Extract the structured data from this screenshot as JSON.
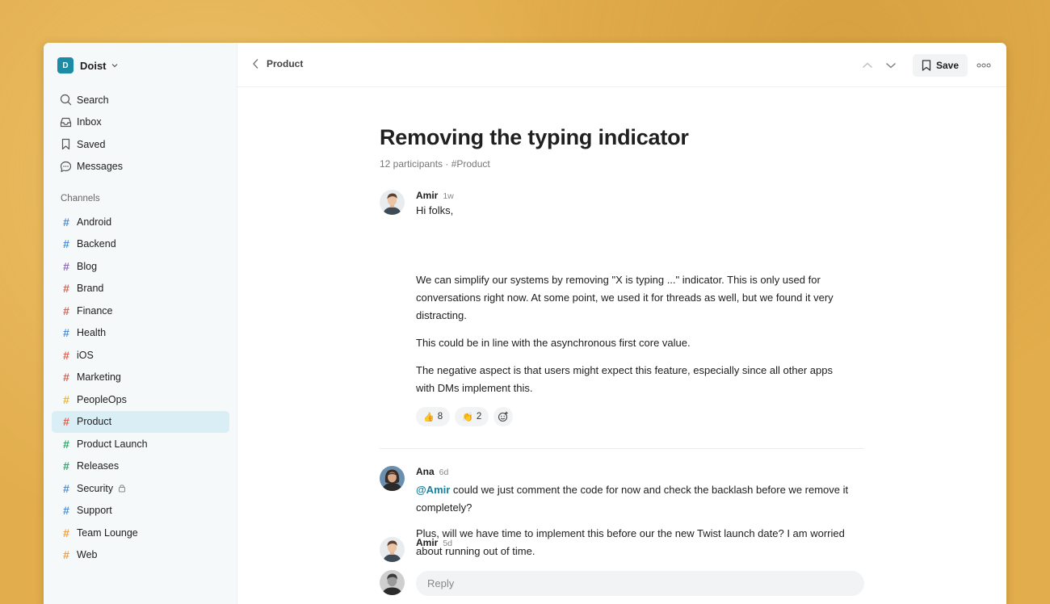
{
  "workspace": {
    "initial": "D",
    "name": "Doist"
  },
  "nav": [
    {
      "label": "Search",
      "icon": "search-icon"
    },
    {
      "label": "Inbox",
      "icon": "inbox-icon"
    },
    {
      "label": "Saved",
      "icon": "bookmark-icon"
    },
    {
      "label": "Messages",
      "icon": "chat-icon"
    }
  ],
  "channels_heading": "Channels",
  "channels": [
    {
      "label": "Android",
      "color": "#4a90d9"
    },
    {
      "label": "Backend",
      "color": "#4a90d9"
    },
    {
      "label": "Blog",
      "color": "#8e6bb8"
    },
    {
      "label": "Brand",
      "color": "#e0604e"
    },
    {
      "label": "Finance",
      "color": "#e0604e"
    },
    {
      "label": "Health",
      "color": "#4a90d9"
    },
    {
      "label": "iOS",
      "color": "#e0604e"
    },
    {
      "label": "Marketing",
      "color": "#e0604e"
    },
    {
      "label": "PeopleOps",
      "color": "#f0b429"
    },
    {
      "label": "Product",
      "color": "#e0604e",
      "active": true
    },
    {
      "label": "Product Launch",
      "color": "#2ea86b"
    },
    {
      "label": "Releases",
      "color": "#2ea86b"
    },
    {
      "label": "Security",
      "color": "#4a90d9",
      "locked": true
    },
    {
      "label": "Support",
      "color": "#4a90d9"
    },
    {
      "label": "Team Lounge",
      "color": "#f0a040"
    },
    {
      "label": "Web",
      "color": "#f0a040"
    }
  ],
  "topbar": {
    "back_label": "Product",
    "save_label": "Save"
  },
  "thread": {
    "title": "Removing the typing indicator",
    "meta": "12 participants · #Product"
  },
  "messages": [
    {
      "author": "Amir",
      "time": "1w",
      "paragraphs": [
        "Hi folks,",
        "We can simplify our systems by removing \"X is typing ...\" indicator. This is only used for conversations right now. At some point, we used it for threads as well, but we found it very distracting.",
        "This could be in line with the asynchronous first core value.",
        "The negative aspect is that users might expect this feature, especially since all other apps with DMs implement this."
      ],
      "reactions": [
        {
          "emoji": "👍",
          "count": "8"
        },
        {
          "emoji": "👏",
          "count": "2"
        }
      ]
    },
    {
      "author": "Ana",
      "time": "6d",
      "mention": "@Amir",
      "paragraphs": [
        "could we just comment the code for now and check the backlash before we remove it completely?",
        "Plus, will we have time to implement this before our the new Twist launch date? I am worried about running out of time."
      ]
    },
    {
      "author": "Amir",
      "time": "5d"
    }
  ],
  "reply": {
    "placeholder": "Reply"
  },
  "colors": {
    "accent": "#1b8ba6",
    "active_channel_bg": "#daeff5",
    "mention": "#1b7f99"
  }
}
